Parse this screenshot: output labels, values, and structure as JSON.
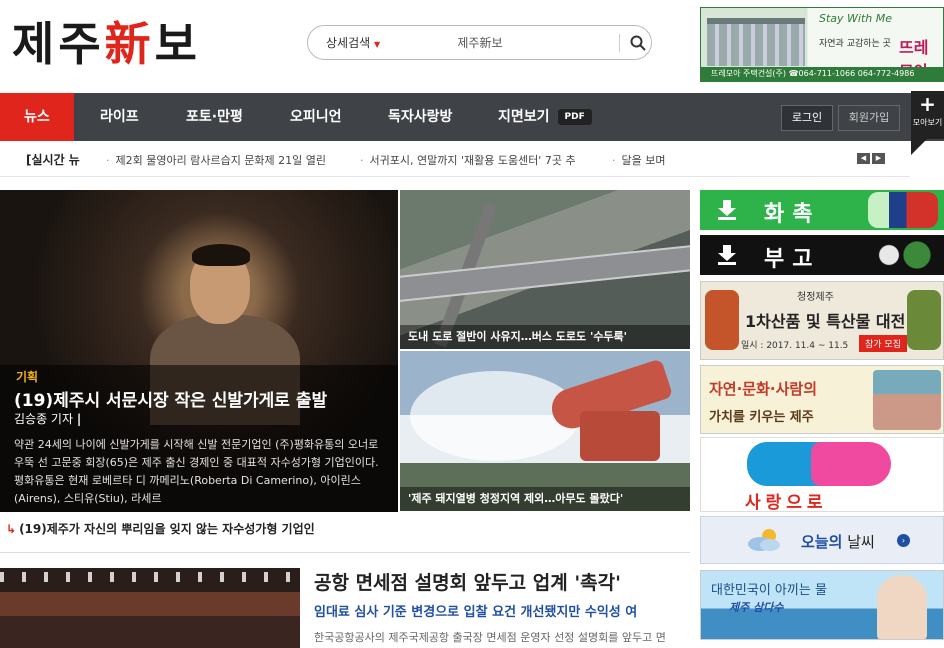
{
  "logo": {
    "text1": "제주",
    "text_red": "新",
    "text2": "보"
  },
  "search": {
    "advanced_label": "상세검색",
    "value": "제주新보"
  },
  "top_ad": {
    "script": "Stay With Me",
    "sub": "자연과 교감하는 곳",
    "brand": "뜨레모아",
    "footer": "뜨레모아 주택건설(주) ☎064-711-1066  064-772-4986"
  },
  "nav": {
    "items": [
      "뉴스",
      "라이프",
      "포토·만평",
      "오피니언",
      "독자사랑방",
      "지면보기"
    ],
    "pdf_badge": "PDF",
    "login": "로그인",
    "join": "회원가입",
    "more_label": "모아보기"
  },
  "ticker": {
    "label": "[실시간 뉴",
    "items": [
      "제2회 물영아리 람사르습지 문화제 21일 열린",
      "서귀포시, 연말까지 '재활용 도움센터' 7곳 추",
      "달을 보며"
    ]
  },
  "feature": {
    "category": "기획",
    "title": "(19)제주시 서문시장 작은 신발가게로 출발",
    "author": "김승종 기자",
    "body": "약관 24세의 나이에 신발가게를 시작해 신발 전문기업인 (주)평화유통의 오너로 우뚝 선 고문중 회장(65)은 제주 출신 경제인 중 대표적 자수성가형 기업인이다. 평화유통은 현재 로베르타 디 까메리노(Roberta Di Camerino), 아이린스(Airens), 스티유(Stiu), 라세르"
  },
  "related": "(19)제주가 자신의 뿌리임을 잊지 않는 자수성가형 기업인",
  "side_news": [
    {
      "caption": "도내 도로 절반이 사유지…버스 도로도 '수두룩'"
    },
    {
      "caption": "'제주 돼지열병 청정지역 제외…아무도 몰랐다'"
    }
  ],
  "article2": {
    "title": "공항 면세점 설명회 앞두고 업계 '촉각'",
    "subtitle": "임대료 심사 기준 변경으로 입찰 요건 개선됐지만 수익성 여",
    "body": "한국공항공사의 제주국제공항 출국장 면세점 운영자 선정 설명회를 앞두고 면"
  },
  "right_ads": {
    "ad1": "화촉",
    "ad2": "부고",
    "ad3": {
      "head": "청정제주",
      "big": "1차산품 및 특산물 대전",
      "date": "일시 : 2017. 11.4 ~ 11.5",
      "button": "참가 모집"
    },
    "ad4": {
      "line1": "자연·문화·사람의",
      "line2": "가치를 키우는 제주"
    },
    "ad5": "사랑으로",
    "ad6": {
      "prefix": "오늘의",
      "suffix": "날씨"
    },
    "ad7": {
      "line1": "대한민국이 아끼는 물",
      "brand": "제주 삼다수"
    }
  },
  "colors": {
    "accent": "#e0261c",
    "nav_bg": "#3f4247",
    "link_blue": "#1f4fa3"
  }
}
